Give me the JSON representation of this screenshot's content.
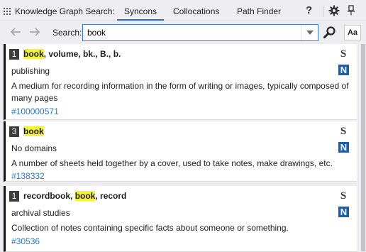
{
  "header": {
    "title": "Knowledge Graph Search:",
    "tabs": [
      {
        "label": "Syncons",
        "active": true
      },
      {
        "label": "Collocations",
        "active": false
      },
      {
        "label": "Path Finder",
        "active": false
      }
    ],
    "help_label": "?",
    "icons": [
      "grip-icon",
      "gear-icon",
      "pin-icon"
    ]
  },
  "search": {
    "label": "Search:",
    "value": "book",
    "case_button_label": "Aa"
  },
  "colors": {
    "accent": "#3373cc",
    "highlight": "#f6f235",
    "link": "#2b7bc4",
    "n_badge": "#1a5fb4"
  },
  "results": [
    {
      "count": "1",
      "lemmas": [
        {
          "text": "book",
          "highlight": true
        },
        {
          "text": ", volume, bk., B., b.",
          "highlight": false
        }
      ],
      "domain": "publishing",
      "gloss": "A medium for recording information in the form of writing or images, typically composed of many pages",
      "id": "#100000571",
      "s_badge": "S",
      "n_badge": "N"
    },
    {
      "count": "3",
      "lemmas": [
        {
          "text": "book",
          "highlight": true
        }
      ],
      "domain": "No domains",
      "gloss": "A number of sheets held together by a cover, used to take notes, make drawings, etc.",
      "id": "#138332",
      "s_badge": "S",
      "n_badge": "N"
    },
    {
      "count": "1",
      "lemmas": [
        {
          "text": "recordbook, ",
          "highlight": false
        },
        {
          "text": "book",
          "highlight": true
        },
        {
          "text": ", record",
          "highlight": false
        }
      ],
      "domain": "archival studies",
      "gloss": "Collection of notes containing specific facts about someone or something.",
      "id": "#30536",
      "s_badge": "S",
      "n_badge": "N"
    }
  ]
}
